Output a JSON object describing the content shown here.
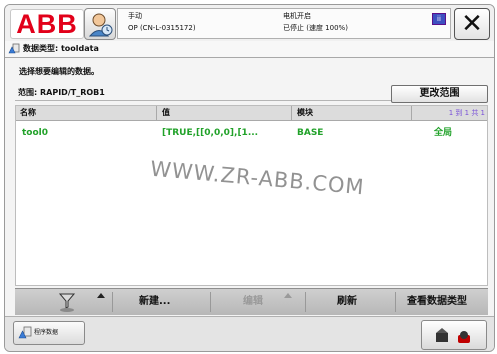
{
  "header": {
    "logo_text": "ABB",
    "status": {
      "mode": "手动",
      "controller": "OP (CN-L-0315172)",
      "motor_state": "电机开启",
      "run_state": "已停止 (速度 100%)",
      "status_icon_glyph": "ii"
    },
    "close_glyph": "✕"
  },
  "title": {
    "text": "数据类型: tooldata"
  },
  "instruction": "选择想要编辑的数据。",
  "scope": {
    "label": "范围: RAPID/T_ROB1",
    "change_button": "更改范围"
  },
  "table": {
    "columns": [
      "名称",
      "值",
      "模块"
    ],
    "page_indicator": "1 到 1 共 1",
    "rows": [
      {
        "name": "tool0",
        "value": "[TRUE,[[0,0,0],[1...",
        "module": "BASE",
        "scope": "全局"
      }
    ]
  },
  "watermark": "WWW.ZR-ABB.COM",
  "toolbar": {
    "new_label": "新建...",
    "edit_label": "编辑",
    "refresh_label": "刷新",
    "view_type_label": "查看数据类型"
  },
  "taskbar": {
    "task_label": "程序数据"
  },
  "colors": {
    "abb_red": "#e2001a",
    "row_text": "#22a22a",
    "page_indicator": "#7a52d8"
  }
}
